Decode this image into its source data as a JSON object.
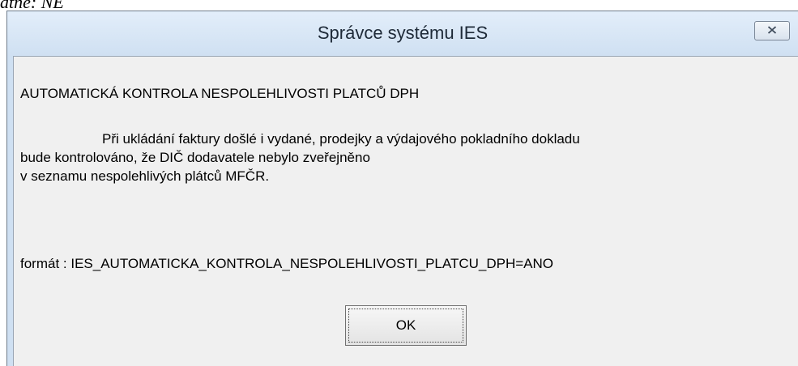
{
  "document": {
    "fragment_text": "atne: NE"
  },
  "dialog": {
    "title": "Správce systému IES",
    "close_icon": "close-icon",
    "heading": "AUTOMATICKÁ KONTROLA NESPOLEHLIVOSTI PLATCŮ DPH",
    "body_lines": [
      "Při ukládání faktury došlé i vydané, prodejky a výdajového pokladního dokladu",
      "bude kontrolováno, že DIČ dodavatele nebylo zveřejněno",
      "v seznamu nespolehlivých plátců MFČR."
    ],
    "format_line": "formát : IES_AUTOMATICKA_KONTROLA_NESPOLEHLIVOSTI_PLATCU_DPH=ANO",
    "ok_label": "OK"
  }
}
